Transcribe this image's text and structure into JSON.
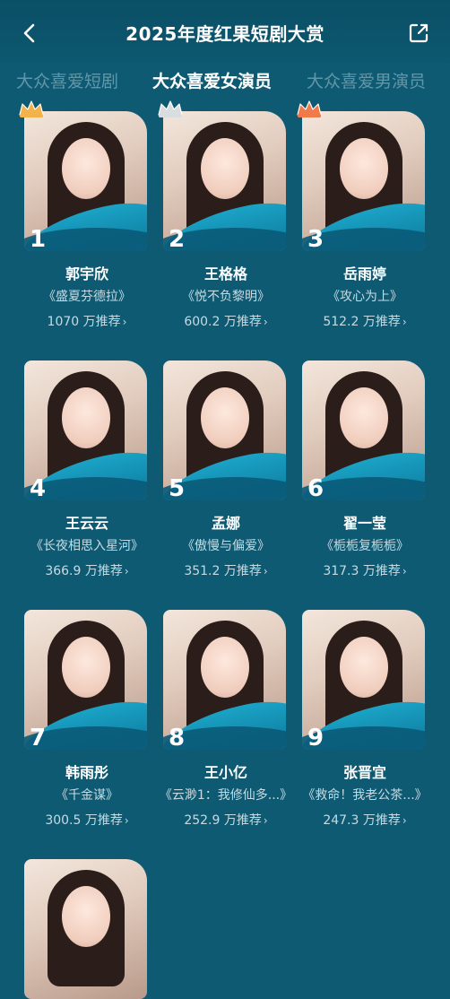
{
  "header": {
    "title": "2025年度红果短剧大赏"
  },
  "tabs": [
    {
      "label": "大众喜爱短剧",
      "active": false
    },
    {
      "label": "大众喜爱女演员",
      "active": true
    },
    {
      "label": "大众喜爱男演员",
      "active": false
    }
  ],
  "actresses": [
    {
      "rank": "1",
      "name": "郭宇欣",
      "drama": "《盛夏芬德拉》",
      "votes": "1070 万推荐",
      "crown": "gold"
    },
    {
      "rank": "2",
      "name": "王格格",
      "drama": "《悦不负黎明》",
      "votes": "600.2 万推荐",
      "crown": "silver"
    },
    {
      "rank": "3",
      "name": "岳雨婷",
      "drama": "《攻心为上》",
      "votes": "512.2 万推荐",
      "crown": "bronze"
    },
    {
      "rank": "4",
      "name": "王云云",
      "drama": "《长夜相思入星河》",
      "votes": "366.9 万推荐"
    },
    {
      "rank": "5",
      "name": "孟娜",
      "drama": "《傲慢与偏爱》",
      "votes": "351.2 万推荐"
    },
    {
      "rank": "6",
      "name": "翟一莹",
      "drama": "《栀栀复栀栀》",
      "votes": "317.3 万推荐"
    },
    {
      "rank": "7",
      "name": "韩雨彤",
      "drama": "《千金谋》",
      "votes": "300.5 万推荐"
    },
    {
      "rank": "8",
      "name": "王小亿",
      "drama": "《云渺1：我修仙多...》",
      "votes": "252.9 万推荐"
    },
    {
      "rank": "9",
      "name": "张晋宜",
      "drama": "《救命！我老公茶...》",
      "votes": "247.3 万推荐"
    }
  ],
  "colors": {
    "background": "#0e5a72",
    "accent_wave": "#1aa3c6",
    "gold": "#f2b44a",
    "silver": "#d9dde0",
    "bronze": "#f07a4a"
  },
  "icons": {
    "back": "chevron-left-icon",
    "share": "share-icon",
    "crown": "crown-icon"
  }
}
